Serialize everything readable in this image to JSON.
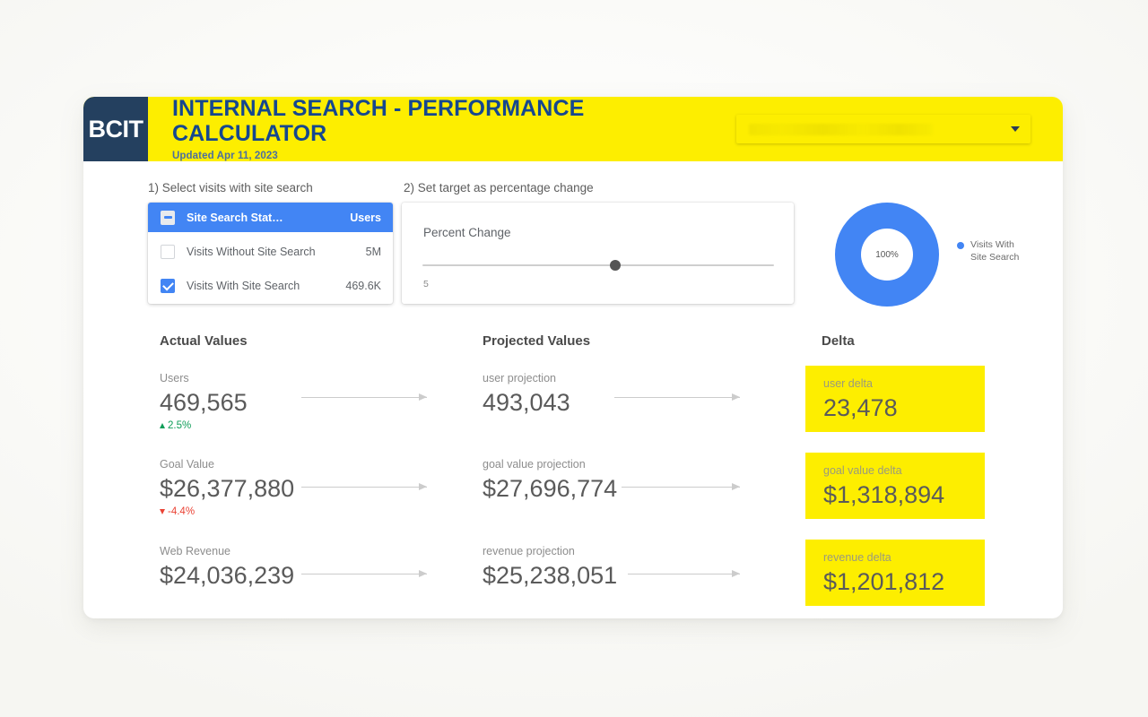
{
  "header": {
    "logo": "BCIT",
    "title": "INTERNAL SEARCH - PERFORMANCE CALCULATOR",
    "subtitle": "Updated Apr 11, 2023",
    "dropdown_value": "",
    "brand_yellow": "#fdee00",
    "brand_navy": "#24405f",
    "title_blue": "#15478f"
  },
  "steps": {
    "step1": "1) Select visits with site search",
    "step2": "2) Set target as percentage change"
  },
  "site_search_list": {
    "header": {
      "dimension": "Site Search Stat…",
      "metric": "Users",
      "checkbox_state": "indeterminate"
    },
    "rows": [
      {
        "label": "Visits Without Site Search",
        "value": "5M",
        "checked": false
      },
      {
        "label": "Visits With Site Search",
        "value": "469.6K",
        "checked": true
      }
    ]
  },
  "percent_change": {
    "title": "Percent Change",
    "value": "5",
    "thumb_position_pct": 53
  },
  "donut": {
    "center_label": "100%",
    "legend": [
      {
        "label_line1": "Visits With",
        "label_line2": "Site Search",
        "color": "#4285f4"
      }
    ]
  },
  "columns": {
    "actual": "Actual Values",
    "projected": "Projected Values",
    "delta": "Delta"
  },
  "metrics": [
    {
      "actual_label": "Users",
      "actual_value": "469,565",
      "trend": "2.5%",
      "trend_direction": "up",
      "projected_label": "user projection",
      "projected_value": "493,043",
      "delta_label": "user delta",
      "delta_value": "23,478"
    },
    {
      "actual_label": "Goal Value",
      "actual_value": "$26,377,880",
      "trend": "-4.4%",
      "trend_direction": "down",
      "projected_label": "goal value projection",
      "projected_value": "$27,696,774",
      "delta_label": "goal value delta",
      "delta_value": "$1,318,894"
    },
    {
      "actual_label": "Web Revenue",
      "actual_value": "$24,036,239",
      "trend": "",
      "trend_direction": "none",
      "projected_label": "revenue projection",
      "projected_value": "$25,238,051",
      "delta_label": "revenue delta",
      "delta_value": "$1,201,812"
    }
  ]
}
